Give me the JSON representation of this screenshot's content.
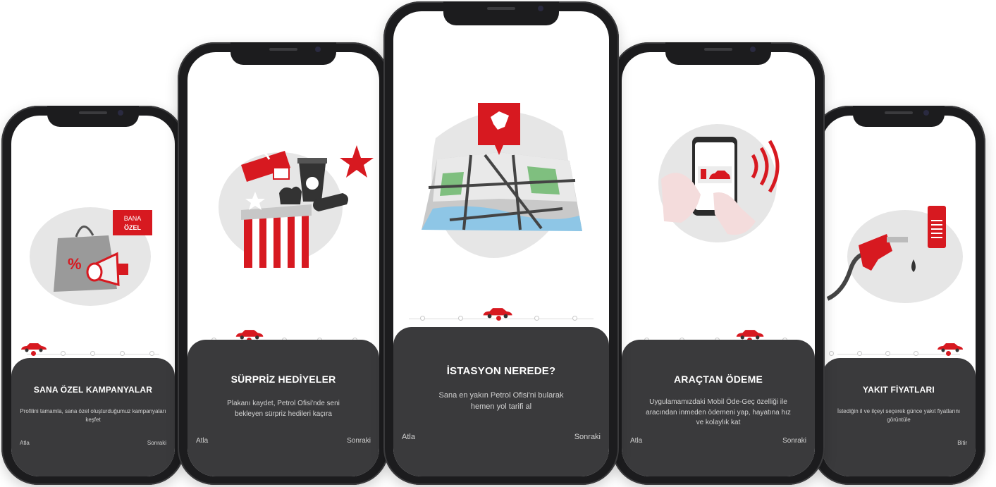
{
  "accent_color": "#d71920",
  "panel_color": "#3a3a3c",
  "screens": [
    {
      "title": "SANA ÖZEL KAMPANYALAR",
      "description": "Profilini tamamla, sana özel oluşturduğumuz kampanyaları keşfet",
      "skip_label": "Atla",
      "next_label": "Sonraki",
      "active_step": 1,
      "badge_top": "BANA",
      "badge_bottom": "ÖZEL",
      "icon": "shopping-bag-megaphone"
    },
    {
      "title": "SÜRPRİZ HEDİYELER",
      "description": "Plakanı kaydet, Petrol Ofisi'nde seni bekleyen sürpriz hedileri kaçıra",
      "skip_label": "Atla",
      "next_label": "Sonraki",
      "active_step": 2,
      "icon": "gift-box"
    },
    {
      "title": "İSTASYON NEREDE?",
      "description": "Sana en yakın Petrol Ofisi'ni bularak hemen yol tarifi al",
      "skip_label": "Atla",
      "next_label": "Sonraki",
      "active_step": 3,
      "icon": "map-pin"
    },
    {
      "title": "ARAÇTAN ÖDEME",
      "description": "Uygulamamızdaki Mobil Öde-Geç özelliği ile aracından inmeden ödemeni yap, hayatına hız ve kolaylık kat",
      "skip_label": "Atla",
      "next_label": "Sonraki",
      "active_step": 4,
      "icon": "phone-payment"
    },
    {
      "title": "YAKIT FİYATLARI",
      "description": "İstediğin il ve ilçeyi seçerek günce yakıt fiyatlarını görüntüle",
      "skip_label": "",
      "next_label": "Bitir",
      "active_step": 5,
      "icon": "fuel-nozzle"
    }
  ]
}
